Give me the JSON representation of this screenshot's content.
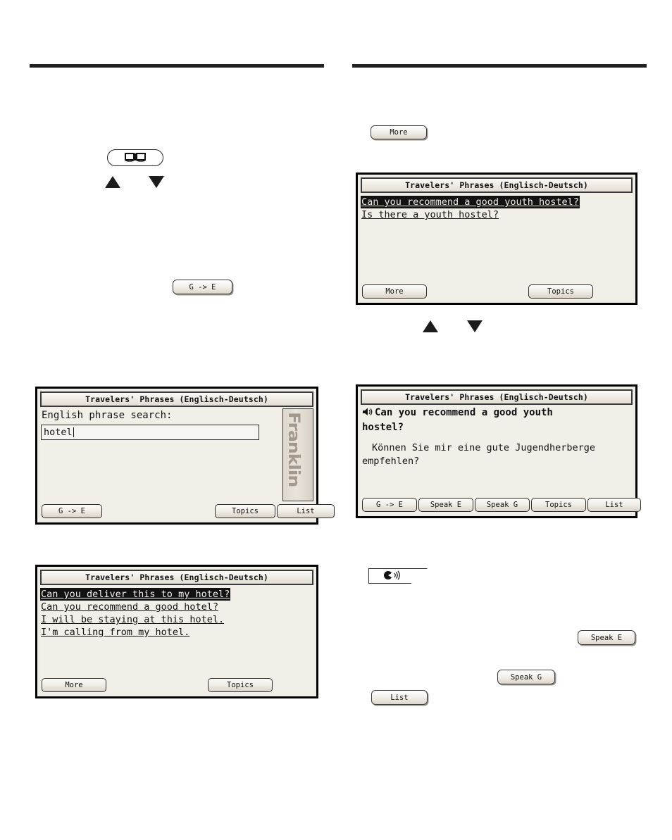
{
  "page": {
    "background_color": "#ffffff",
    "rule_color": "#212121"
  },
  "icons": {
    "book_button": "book-icon",
    "speaker_button": "speaker-icon",
    "arrow_up": "arrow-up-icon",
    "arrow_down": "arrow-down-icon",
    "speaker_inline": "speaker-small-icon"
  },
  "left_column": {
    "book_key_label": "",
    "ge_key_label": "G -> E",
    "screen_search": {
      "title": "Travelers' Phrases (Englisch-Deutsch)",
      "prompt": "English phrase search:",
      "input_value": "hotel",
      "input_placeholder": "",
      "scroll_watermark": "Franklin",
      "buttons": [
        {
          "label": "G -> E"
        },
        {
          "label": "Topics"
        },
        {
          "label": "List"
        }
      ]
    },
    "screen_results": {
      "title": "Travelers' Phrases (Englisch-Deutsch)",
      "rows": [
        {
          "text": "Can you deliver this to my hotel?",
          "selected": true
        },
        {
          "text": "Can you recommend a good hotel?",
          "selected": false
        },
        {
          "text": "I will be staying at this hotel.",
          "selected": false
        },
        {
          "text": "I'm calling from my hotel.",
          "selected": false
        }
      ],
      "buttons": [
        {
          "label": "More"
        },
        {
          "label": "Topics"
        }
      ]
    }
  },
  "right_column": {
    "more_key_label": "More",
    "speak_e_key_label": "Speak E",
    "speak_g_key_label": "Speak G",
    "list_key_label": "List",
    "screen_hostel_list": {
      "title": "Travelers' Phrases (Englisch-Deutsch)",
      "rows": [
        {
          "text": "Can you recommend a good youth hostel?",
          "selected": true
        },
        {
          "text": "Is there a youth hostel?",
          "selected": false
        }
      ],
      "buttons": [
        {
          "label": "More"
        },
        {
          "label": "Topics"
        }
      ]
    },
    "screen_translation": {
      "title": "Travelers' Phrases (Englisch-Deutsch)",
      "english_line1": "Can you recommend a good youth",
      "english_line2": "hostel?",
      "german_line1": "Können Sie mir eine gute Jugendherberge",
      "german_line2": "empfehlen?",
      "buttons": [
        {
          "label": "G -> E"
        },
        {
          "label": "Speak E"
        },
        {
          "label": "Speak G"
        },
        {
          "label": "Topics"
        },
        {
          "label": "List"
        }
      ]
    }
  }
}
